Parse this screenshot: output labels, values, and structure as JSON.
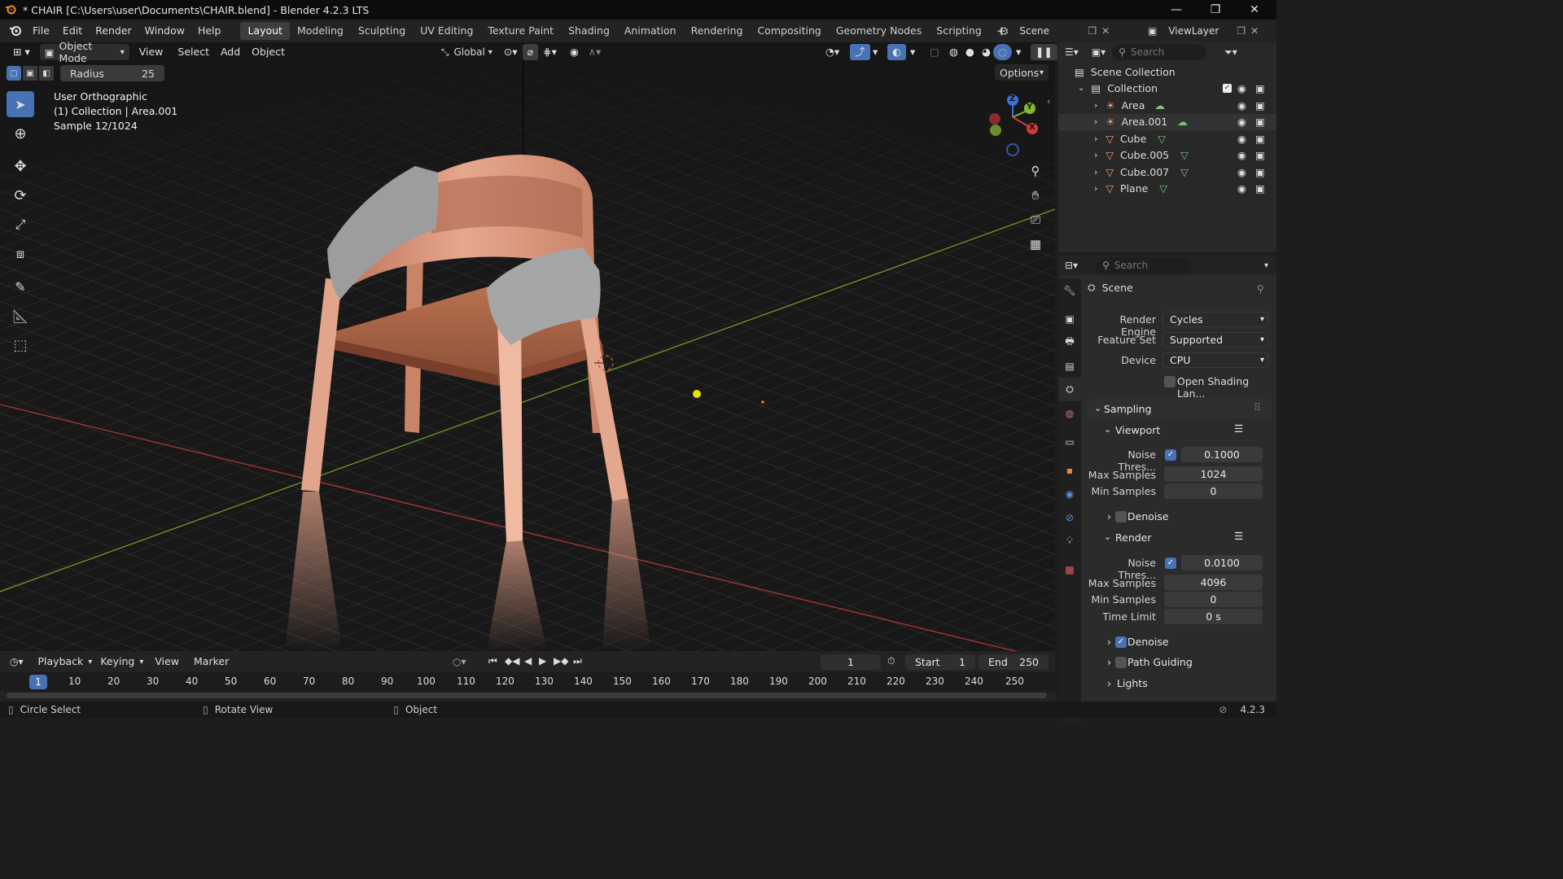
{
  "titlebar": {
    "title": "* CHAIR [C:\\Users\\user\\Documents\\CHAIR.blend] - Blender 4.2.3 LTS",
    "minimize": "—",
    "maximize": "❐",
    "close": "✕"
  },
  "menu": [
    "File",
    "Edit",
    "Render",
    "Window",
    "Help"
  ],
  "workspaces": [
    "Layout",
    "Modeling",
    "Sculpting",
    "UV Editing",
    "Texture Paint",
    "Shading",
    "Animation",
    "Rendering",
    "Compositing",
    "Geometry Nodes",
    "Scripting"
  ],
  "active_workspace": "Layout",
  "scene": {
    "name": "Scene",
    "view_layer": "ViewLayer"
  },
  "viewport_header": {
    "mode": "Object Mode",
    "view": "View",
    "select": "Select",
    "add": "Add",
    "object": "Object",
    "orientation": "Global",
    "options": "Options"
  },
  "tool_settings": {
    "radius_label": "Radius",
    "radius_value": "25"
  },
  "viewport_info": {
    "line1": "User Orthographic",
    "line2": "(1) Collection | Area.001",
    "line3": "Sample 12/1024"
  },
  "gizmo": {
    "x": "X",
    "y": "Y",
    "z": "Z"
  },
  "outliner": {
    "search_placeholder": "Search",
    "scene_collection": "Scene Collection",
    "collection": "Collection",
    "items": [
      {
        "name": "Area",
        "type": "light"
      },
      {
        "name": "Area.001",
        "type": "light"
      },
      {
        "name": "Cube",
        "type": "mesh"
      },
      {
        "name": "Cube.005",
        "type": "mesh"
      },
      {
        "name": "Cube.007",
        "type": "mesh"
      },
      {
        "name": "Plane",
        "type": "mesh"
      }
    ]
  },
  "properties": {
    "search_placeholder": "Search",
    "context": "Scene",
    "render_engine_label": "Render Engine",
    "render_engine": "Cycles",
    "feature_set_label": "Feature Set",
    "feature_set": "Supported",
    "device_label": "Device",
    "device": "CPU",
    "osl_label": "Open Shading Lan...",
    "sampling": "Sampling",
    "viewport": "Viewport",
    "vp_noise_label": "Noise Thres...",
    "vp_noise": "0.1000",
    "vp_max_label": "Max Samples",
    "vp_max": "1024",
    "vp_min_label": "Min Samples",
    "vp_min": "0",
    "vp_denoise": "Denoise",
    "render": "Render",
    "r_noise_label": "Noise Thres...",
    "r_noise": "0.0100",
    "r_max_label": "Max Samples",
    "r_max": "4096",
    "r_min_label": "Min Samples",
    "r_min": "0",
    "r_time_label": "Time Limit",
    "r_time": "0 s",
    "r_denoise": "Denoise",
    "path_guiding": "Path Guiding",
    "lights": "Lights"
  },
  "timeline": {
    "playback": "Playback",
    "keying": "Keying",
    "view": "View",
    "marker": "Marker",
    "current_frame": "1",
    "start_label": "Start",
    "start": "1",
    "end_label": "End",
    "end": "250",
    "ruler": [
      "1",
      "10",
      "20",
      "30",
      "40",
      "50",
      "60",
      "70",
      "80",
      "90",
      "100",
      "110",
      "120",
      "130",
      "140",
      "150",
      "160",
      "170",
      "180",
      "190",
      "200",
      "210",
      "220",
      "230",
      "240",
      "250"
    ]
  },
  "statusbar": {
    "left": "Circle Select",
    "middle": "Rotate View",
    "right": "Object",
    "version": "4.2.3"
  },
  "colors": {
    "accent": "#4772b3",
    "wood": "#d9957a",
    "fabric": "#9e9e9e",
    "x_axis": "#c0392b",
    "y_axis": "#7fae2b",
    "light": "#e8e000"
  }
}
